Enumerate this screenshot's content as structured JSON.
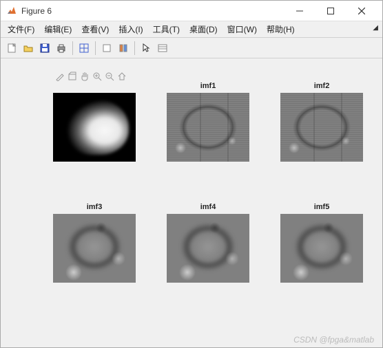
{
  "window": {
    "title": "Figure 6"
  },
  "menu": {
    "file": "文件(F)",
    "edit": "编辑(E)",
    "view": "查看(V)",
    "insert": "插入(I)",
    "tools": "工具(T)",
    "desktop": "桌面(D)",
    "window": "窗口(W)",
    "help": "帮助(H)"
  },
  "toolbar_icons": {
    "new": "new",
    "open": "open",
    "save": "save",
    "print": "print",
    "datacursor": "datacursor",
    "linkplot": "linkplot",
    "colorbar": "colorbar",
    "legend": "legend",
    "pointer": "pointer",
    "panel": "panel"
  },
  "fig_toolbar": {
    "brush": "brush",
    "rotate": "rotate",
    "pan": "pan",
    "zoomin": "zoomin",
    "zoomout": "zoomout",
    "home": "home"
  },
  "subplots": {
    "r1c1": {
      "title": ""
    },
    "r1c2": {
      "title": "imf1"
    },
    "r1c3": {
      "title": "imf2"
    },
    "r2c1": {
      "title": "imf3"
    },
    "r2c2": {
      "title": "imf4"
    },
    "r2c3": {
      "title": "imf5"
    }
  },
  "watermark": "CSDN @fpga&matlab"
}
